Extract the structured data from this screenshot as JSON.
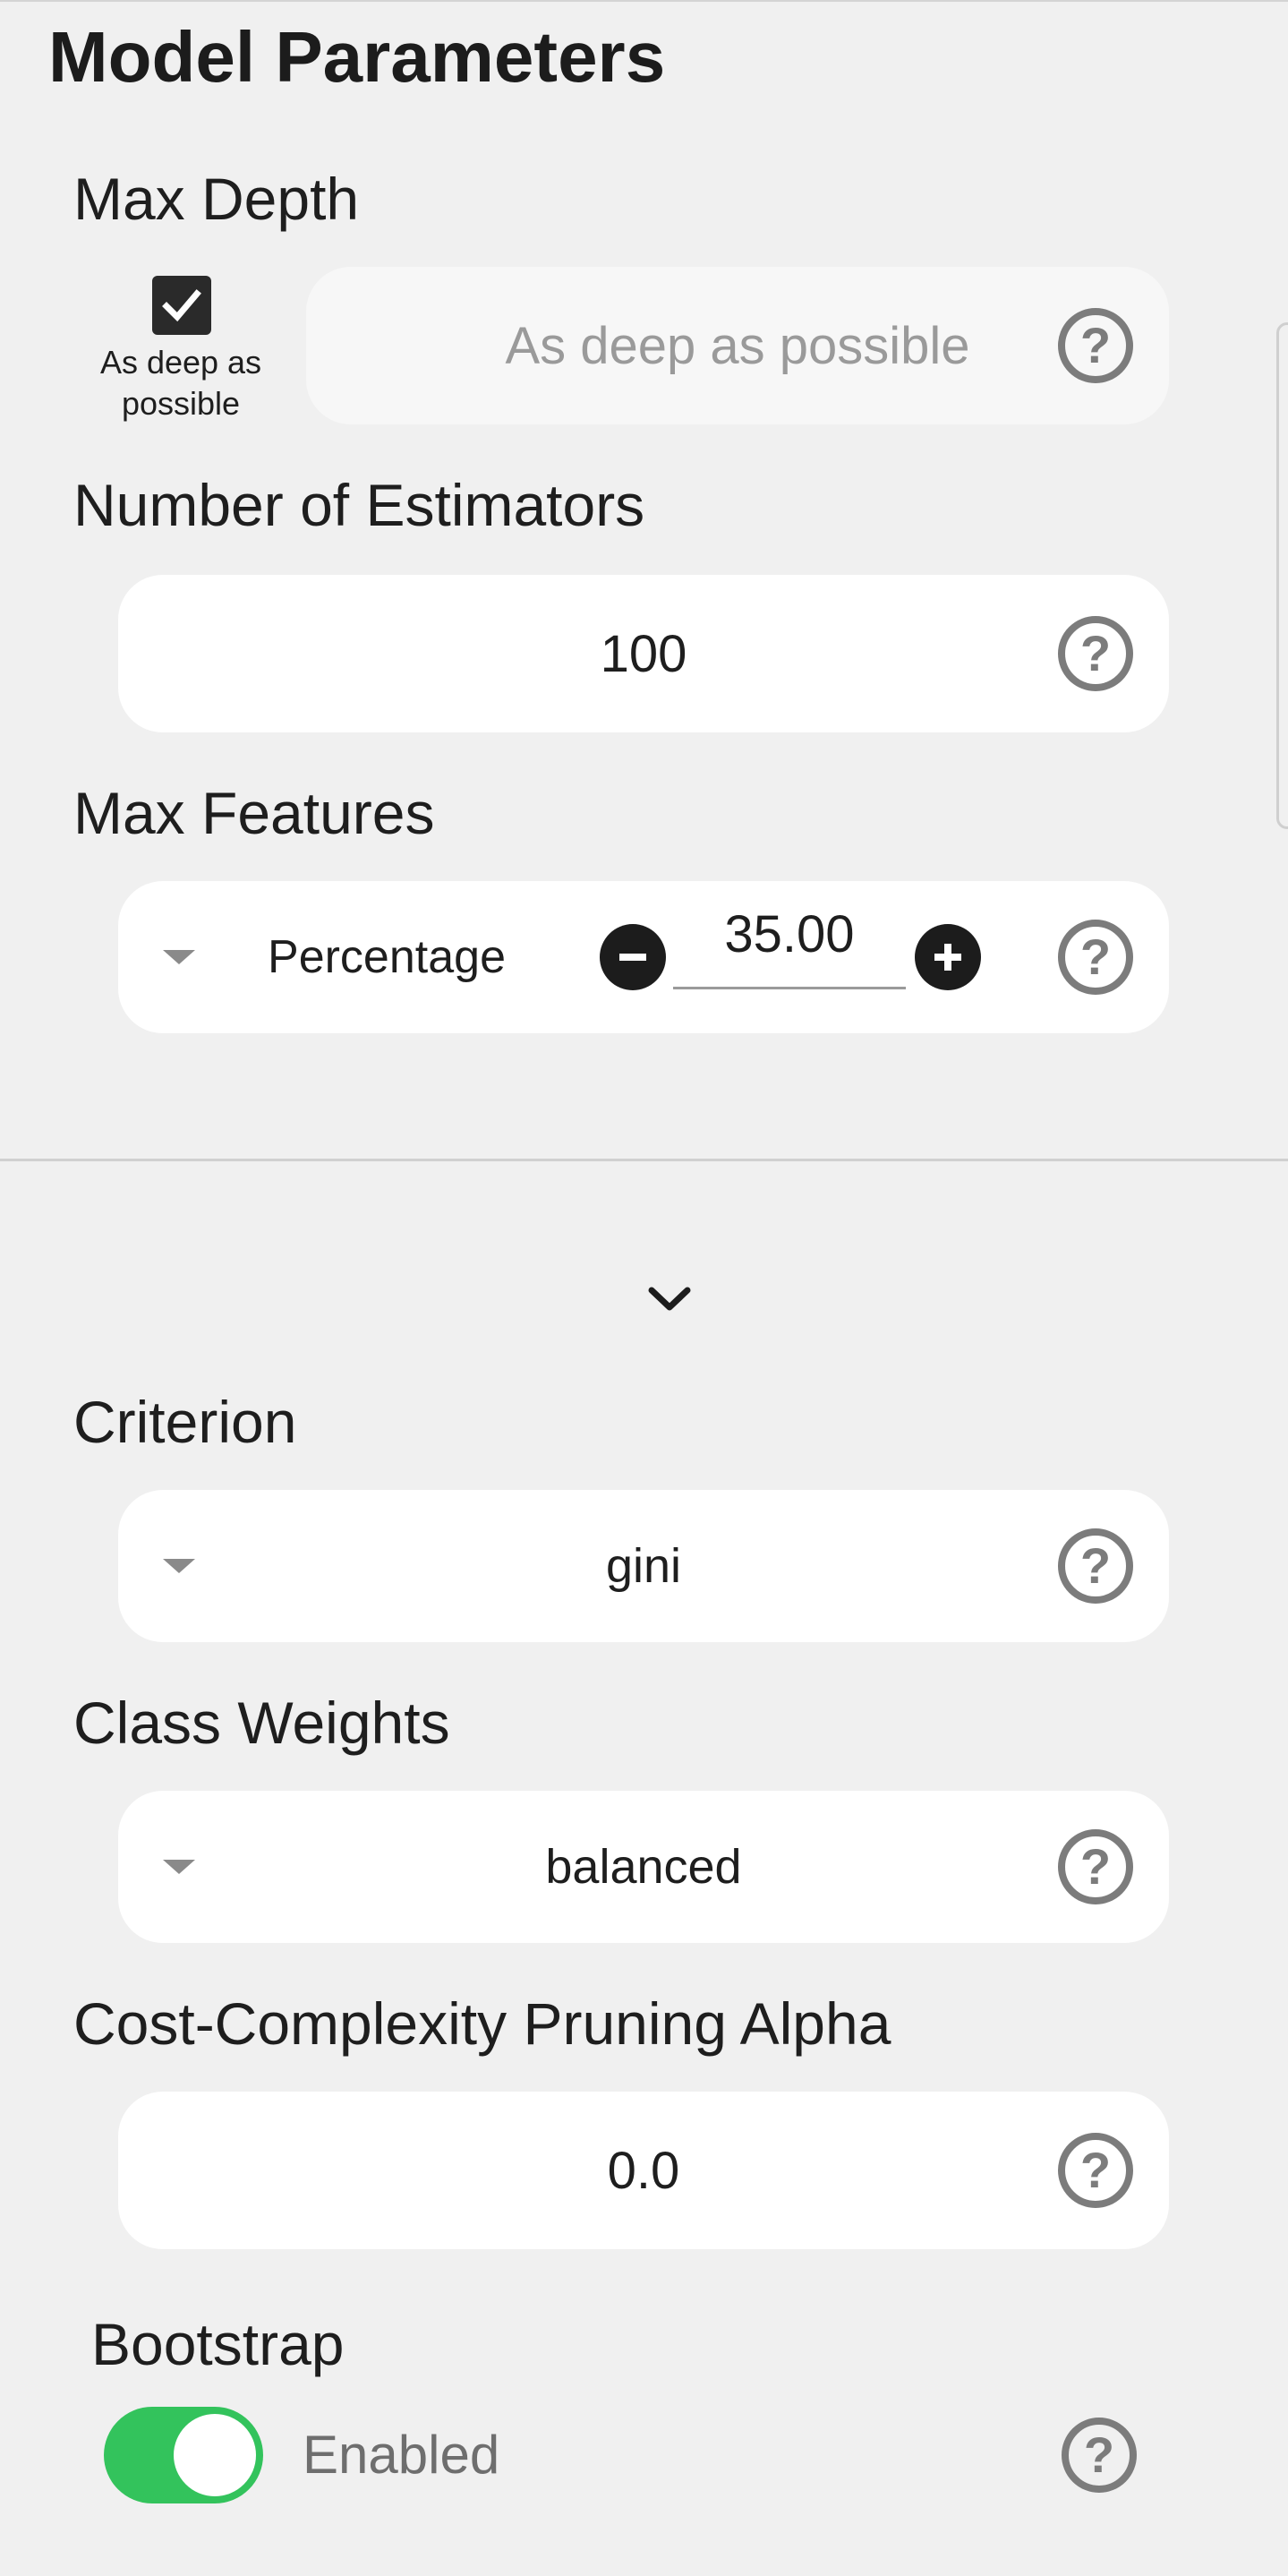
{
  "page": {
    "title": "Model Parameters"
  },
  "max_depth": {
    "label": "Max Depth",
    "checkbox_checked": true,
    "checkbox_label": "As deep as possible",
    "placeholder": "As deep as possible"
  },
  "n_estimators": {
    "label": "Number of Estimators",
    "value": "100"
  },
  "max_features": {
    "label": "Max Features",
    "mode": "Percentage",
    "value": "35.00"
  },
  "criterion": {
    "label": "Criterion",
    "value": "gini"
  },
  "class_weights": {
    "label": "Class Weights",
    "value": "balanced"
  },
  "ccp_alpha": {
    "label": "Cost-Complexity Pruning Alpha",
    "value": "0.0"
  },
  "bootstrap": {
    "label": "Bootstrap",
    "state_label": "Enabled",
    "enabled": true
  },
  "colors": {
    "accent_toggle": "#33c35c",
    "help_icon": "#7c7c7c"
  }
}
